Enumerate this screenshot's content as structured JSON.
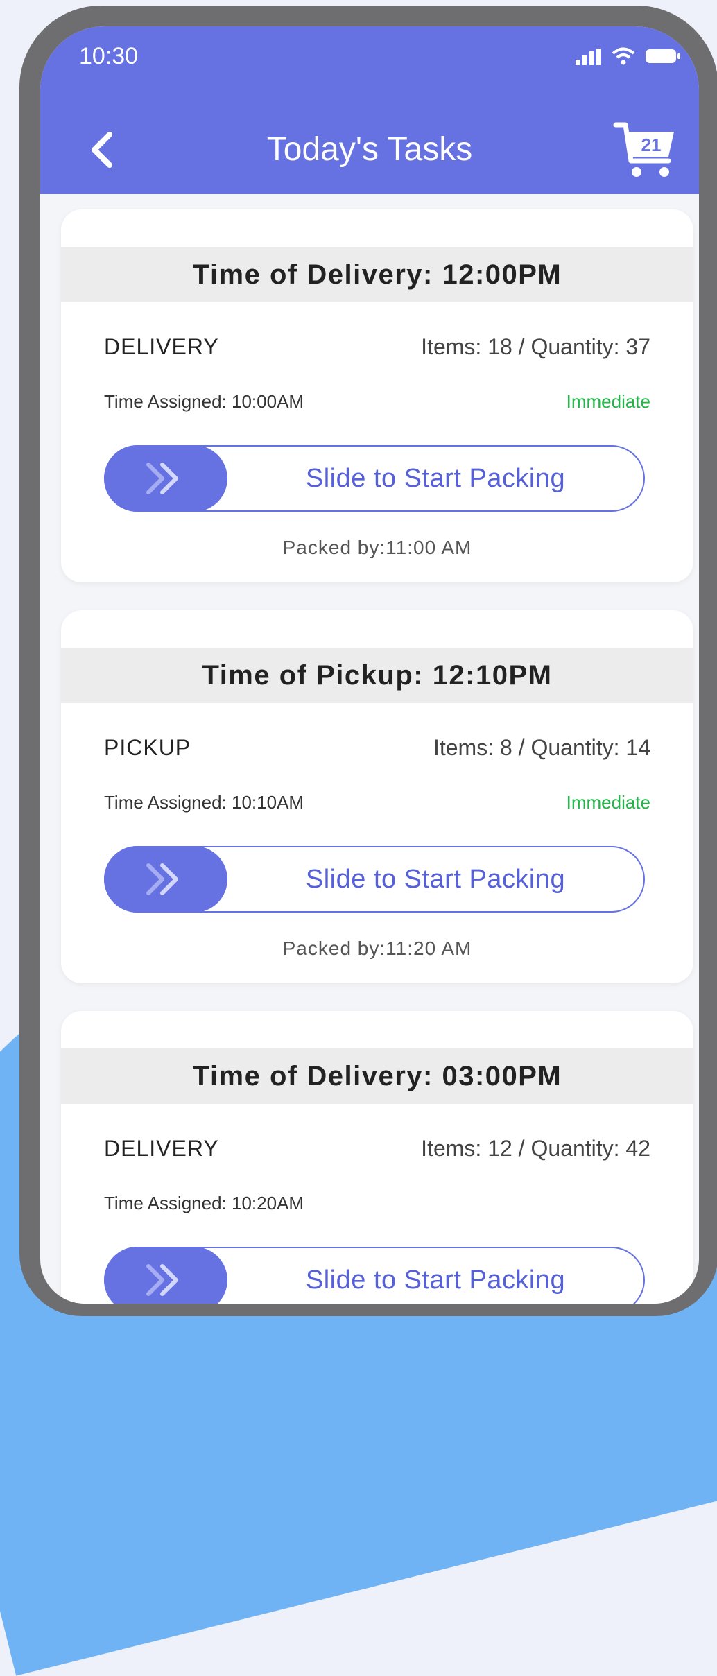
{
  "status_bar": {
    "time": "10:30"
  },
  "header": {
    "title": "Today's Tasks",
    "cart_count": "21"
  },
  "tasks": [
    {
      "heading": "Time of Delivery: 12:00PM",
      "type": "DELIVERY",
      "items": "Items: 18 / Quantity: 37",
      "assigned": "Time Assigned: 10:00AM",
      "priority": "Immediate",
      "slider_label": "Slide to Start Packing",
      "packed_by": "Packed by:11:00 AM"
    },
    {
      "heading": "Time of Pickup: 12:10PM",
      "type": "PICKUP",
      "items": "Items: 8 / Quantity: 14",
      "assigned": "Time Assigned: 10:10AM",
      "priority": "Immediate",
      "slider_label": "Slide to Start Packing",
      "packed_by": "Packed by:11:20 AM"
    },
    {
      "heading": "Time of Delivery: 03:00PM",
      "type": "DELIVERY",
      "items": "Items: 12 / Quantity: 42",
      "assigned": "Time Assigned: 10:20AM",
      "priority": "",
      "slider_label": "Slide to Start Packing",
      "packed_by": ""
    }
  ],
  "colors": {
    "accent": "#6672e2",
    "priority": "#23b54a",
    "background_blob": "#6fb3f5"
  },
  "icons": [
    "back-chevron-icon",
    "cart-icon",
    "signal-icon",
    "wifi-icon",
    "battery-icon",
    "double-chevron-right-icon"
  ]
}
